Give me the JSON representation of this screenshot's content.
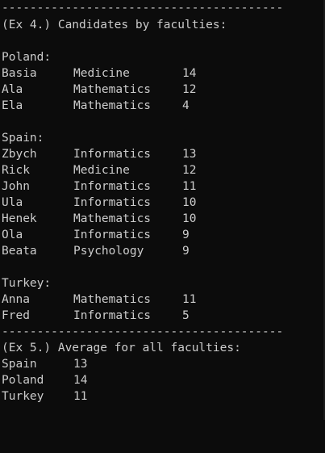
{
  "separator": "----------------------------------------",
  "ex4": {
    "header": "(Ex 4.) Candidates by faculties:",
    "groups": [
      {
        "country": "Poland:",
        "rows": [
          {
            "name": "Basia",
            "faculty": "Medicine",
            "points": "14"
          },
          {
            "name": "Ala",
            "faculty": "Mathematics",
            "points": "12"
          },
          {
            "name": "Ela",
            "faculty": "Mathematics",
            "points": "4"
          }
        ]
      },
      {
        "country": "Spain:",
        "rows": [
          {
            "name": "Zbych",
            "faculty": "Informatics",
            "points": "13"
          },
          {
            "name": "Rick",
            "faculty": "Medicine",
            "points": "12"
          },
          {
            "name": "John",
            "faculty": "Informatics",
            "points": "11"
          },
          {
            "name": "Ula",
            "faculty": "Informatics",
            "points": "10"
          },
          {
            "name": "Henek",
            "faculty": "Mathematics",
            "points": "10"
          },
          {
            "name": "Ola",
            "faculty": "Informatics",
            "points": "9"
          },
          {
            "name": "Beata",
            "faculty": "Psychology",
            "points": "9"
          }
        ]
      },
      {
        "country": "Turkey:",
        "rows": [
          {
            "name": "Anna",
            "faculty": "Mathematics",
            "points": "11"
          },
          {
            "name": "Fred",
            "faculty": "Informatics",
            "points": "5"
          }
        ]
      }
    ]
  },
  "ex5": {
    "header": "(Ex 5.) Average for all faculties:",
    "rows": [
      {
        "country": "Spain",
        "average": "13"
      },
      {
        "country": "Poland",
        "average": "14"
      },
      {
        "country": "Turkey",
        "average": "11"
      }
    ]
  }
}
